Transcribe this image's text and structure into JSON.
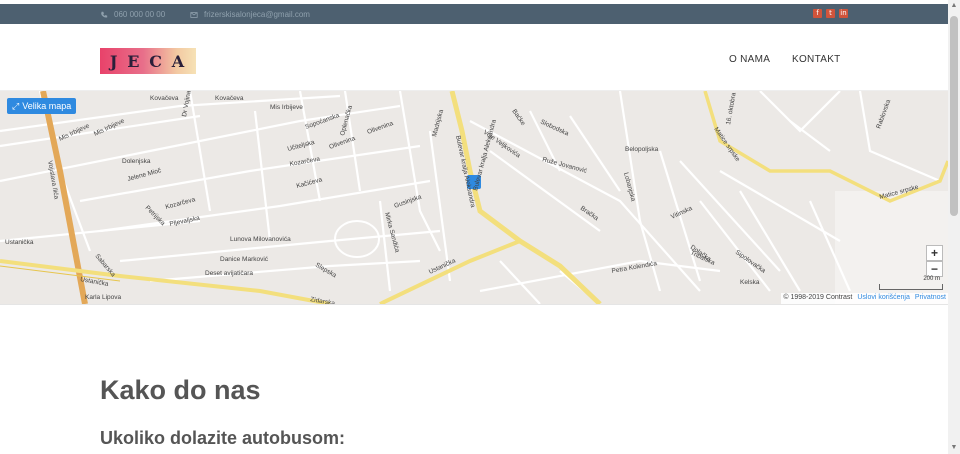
{
  "topbar": {
    "phone": "060 000 00 00",
    "email": "frizerskisalonjeca@gmail.com",
    "social": [
      "f",
      "t",
      "in"
    ]
  },
  "logo": {
    "text": [
      "J",
      "E",
      "C",
      "A"
    ]
  },
  "nav": {
    "items": [
      "O NAMA",
      "KONTAKT"
    ]
  },
  "map": {
    "big_map_label": "Velika mapa",
    "zoom_in": "+",
    "zoom_out": "−",
    "copyright": "© 1998-2019 Contrast",
    "terms": "Uslovi korišćenja",
    "privacy": "Privatnost",
    "scale": "200 m",
    "streets": [
      "Kovačeva",
      "Kovačeva",
      "Mis Irbijeve",
      "Dr Vojina",
      "Mis Irbijeve",
      "Mis Irbijeve",
      "Sopoćanska",
      "Oplenačka",
      "Madrijska",
      "Olivenina",
      "Olivenina",
      "Učiteljska",
      "Kozarčeva",
      "Bulevar kralja Aleksandra",
      "Voje Veljkovića",
      "Baćke",
      "Slobodska",
      "Ruže Jovanović",
      "Belopoljska",
      "Lobanjska",
      "Matice srpske",
      "16. oktobra",
      "Rablovska",
      "Dolenjska",
      "Jelene Mioč",
      "Kozarčeva",
      "Petrijska",
      "Pljevaljska",
      "Kačićeva",
      "Gusinjska",
      "Bulevar kralja Aleksandra",
      "Mirka Sandića",
      "Lunova Milovanovića",
      "Danice Marković",
      "Deset avijatičara",
      "Ustanička",
      "Ustanička",
      "Ustanička",
      "Karla Lipova",
      "Petra Kolendića",
      "Bračka",
      "Vitinska",
      "Dolačka",
      "Kelska",
      "Tribalska",
      "Sipolovačka",
      "Matice srpske",
      "Vojislava Ilića",
      "Sabarska",
      "Slepska",
      "Zidarska"
    ]
  },
  "content": {
    "heading": "Kako do nas",
    "subheading": "Ukoliko dolazite autobusom:"
  }
}
